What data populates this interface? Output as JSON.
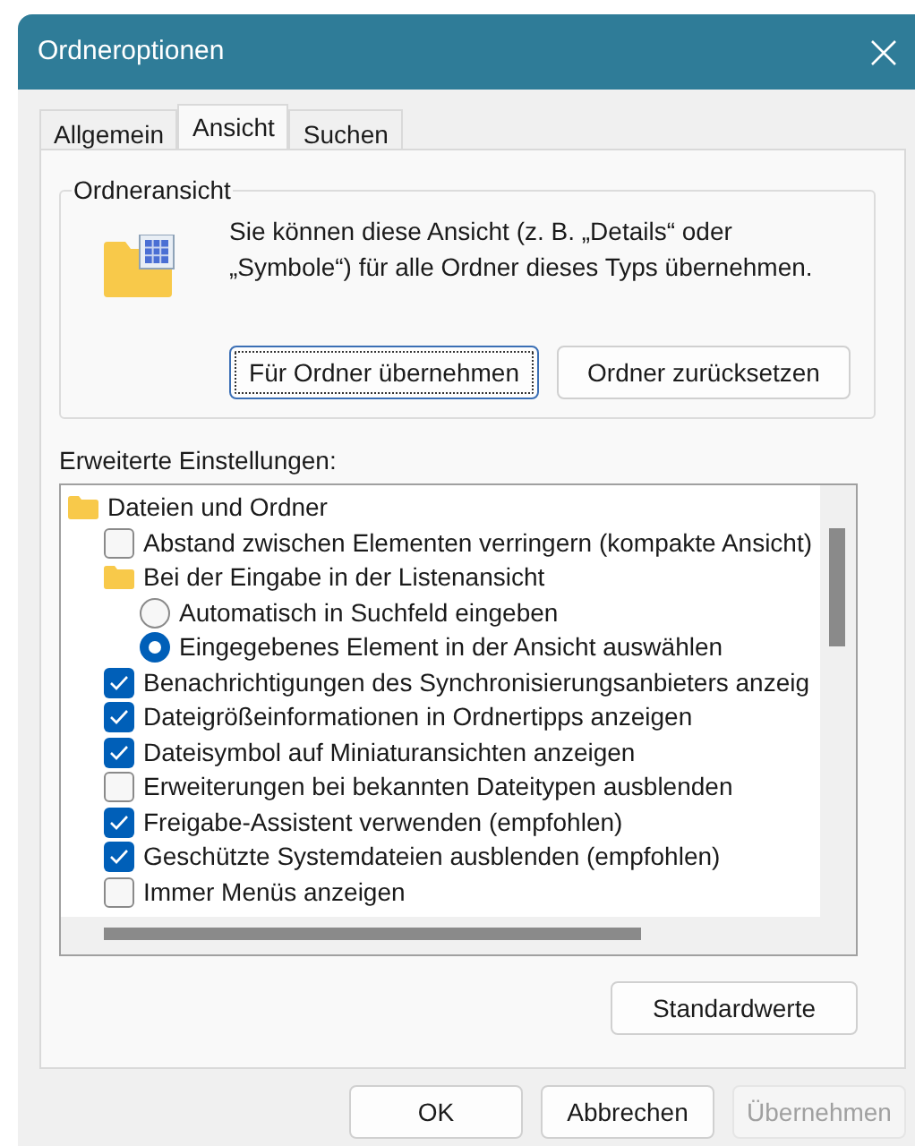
{
  "window": {
    "title": "Ordneroptionen"
  },
  "tabs": [
    {
      "label": "Allgemein",
      "selected": false
    },
    {
      "label": "Ansicht",
      "selected": true
    },
    {
      "label": "Suchen",
      "selected": false
    }
  ],
  "folder_view": {
    "title": "Ordneransicht",
    "text": "Sie können diese Ansicht (z. B. „Details“ oder „Symbole“) für alle Ordner dieses Typs übernehmen.",
    "buttons": [
      {
        "label": "Für Ordner übernehmen",
        "focused": true
      },
      {
        "label": "Ordner zurücksetzen",
        "focused": false
      }
    ]
  },
  "advanced": {
    "label": "Erweiterte Einstellungen:",
    "items": [
      {
        "kind": "folder",
        "label": "Dateien und Ordner",
        "children": [
          {
            "kind": "checkbox",
            "label": "Abstand zwischen Elementen verringern (kompakte Ansicht)",
            "checked": false
          },
          {
            "kind": "folder",
            "label": "Bei der Eingabe in der Listenansicht",
            "children": [
              {
                "kind": "radio",
                "label": "Automatisch in Suchfeld eingeben",
                "selected": false
              },
              {
                "kind": "radio",
                "label": "Eingegebenes Element in der Ansicht auswählen",
                "selected": true
              }
            ]
          },
          {
            "kind": "checkbox",
            "label": "Benachrichtigungen des Synchronisierungsanbieters anzeig",
            "checked": true
          },
          {
            "kind": "checkbox",
            "label": "Dateigrößeinformationen in Ordnertipps anzeigen",
            "checked": true
          },
          {
            "kind": "checkbox",
            "label": "Dateisymbol auf Miniaturansichten anzeigen",
            "checked": true
          },
          {
            "kind": "checkbox",
            "label": "Erweiterungen bei bekannten Dateitypen ausblenden",
            "checked": false
          },
          {
            "kind": "checkbox",
            "label": "Freigabe-Assistent verwenden (empfohlen)",
            "checked": true
          },
          {
            "kind": "checkbox",
            "label": "Geschützte Systemdateien ausblenden (empfohlen)",
            "checked": true
          },
          {
            "kind": "checkbox",
            "label": "Immer Menüs anzeigen",
            "checked": false
          }
        ]
      }
    ],
    "defaults_button": "Standardwerte"
  },
  "buttons": [
    {
      "label": "OK",
      "disabled": false
    },
    {
      "label": "Abbrechen",
      "disabled": false
    },
    {
      "label": "Übernehmen",
      "disabled": true
    }
  ]
}
